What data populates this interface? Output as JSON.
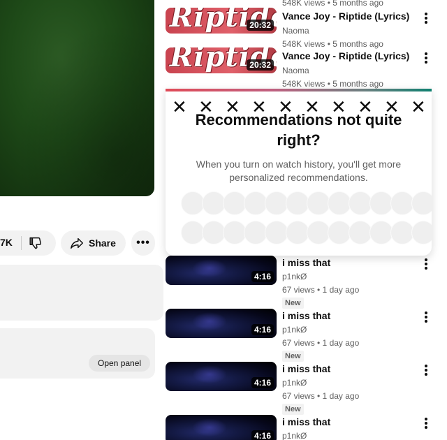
{
  "player": {
    "state": "playing"
  },
  "actions": {
    "like_count": "7K",
    "share_label": "Share",
    "more_label": "•••"
  },
  "description_panel": {
    "open_panel_label": "Open panel"
  },
  "recommendations": [
    {
      "title": "Vance Joy - Riptide (Lyrics)",
      "channel": "Naoma",
      "meta": "548K views • 5 months ago",
      "duration": "20:32",
      "thumb_text": "Riptide"
    },
    {
      "title": "Vance Joy - Riptide (Lyrics)",
      "channel": "Naoma",
      "meta": "548K views • 5 months ago",
      "duration": "20:32",
      "thumb_text": "Riptide"
    },
    {
      "title": "i miss that",
      "channel": "p1nkØ",
      "meta": "67 views • 1 day ago",
      "duration": "4:16",
      "badge": "New"
    },
    {
      "title": "i miss that",
      "channel": "p1nkØ",
      "meta": "67 views • 1 day ago",
      "duration": "4:16",
      "badge": "New"
    },
    {
      "title": "i miss that",
      "channel": "p1nkØ",
      "meta": "67 views • 1 day ago",
      "duration": "4:16",
      "badge": "New"
    },
    {
      "title": "i miss that",
      "channel": "p1nkØ"
    }
  ],
  "top_partial_meta": "548K views • 5 months ago",
  "popup": {
    "title_line1": "Recommendations not quite",
    "title_line2": "right?",
    "body_line1": "When you turn on watch history, you'll get more",
    "body_line2": "personalized recommendations.",
    "x_glyph": "✕"
  },
  "colors": {
    "accent_stripe": [
      "#e04b57",
      "#108070"
    ],
    "pill_bg": "#f2f2f2",
    "meta_text": "#606060"
  }
}
